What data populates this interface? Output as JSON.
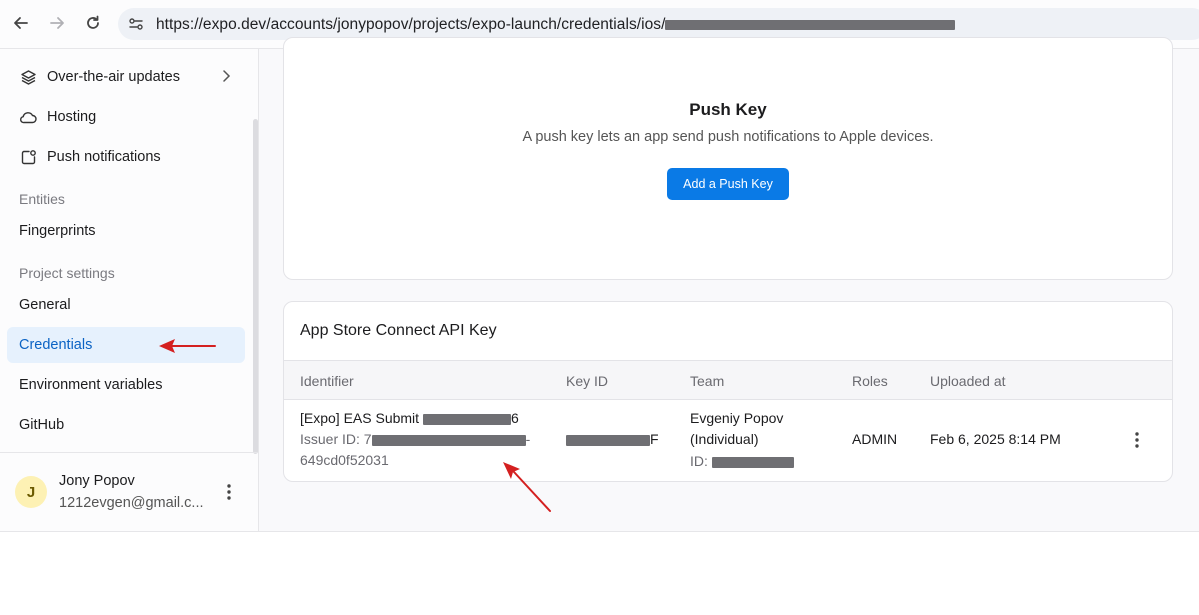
{
  "browser": {
    "url_visible": "https://expo.dev/accounts/jonypopov/projects/expo-launch/credentials/ios/"
  },
  "sidebar": {
    "items": [
      {
        "label": "Over-the-air updates"
      },
      {
        "label": "Hosting"
      },
      {
        "label": "Push notifications"
      }
    ],
    "sections": {
      "entities": "Entities",
      "project_settings": "Project settings"
    },
    "entities_items": [
      {
        "label": "Fingerprints"
      }
    ],
    "settings_items": [
      {
        "label": "General"
      },
      {
        "label": "Credentials"
      },
      {
        "label": "Environment variables"
      },
      {
        "label": "GitHub"
      }
    ],
    "user": {
      "initial": "J",
      "name": "Jony Popov",
      "email": "1212evgen@gmail.c..."
    }
  },
  "push_key": {
    "title": "Push Key",
    "description": "A push key lets an app send push notifications to Apple devices.",
    "button": "Add a Push Key"
  },
  "api_key": {
    "title": "App Store Connect API Key",
    "columns": [
      "Identifier",
      "Key ID",
      "Team",
      "Roles",
      "Uploaded at"
    ],
    "row": {
      "identifier_prefix": "[Expo] EAS Submit",
      "identifier_suffix": "6",
      "issuer_prefix": "Issuer ID: 7",
      "issuer_tail": "-",
      "issuer_line2": "649cd0f52031",
      "key_id_suffix": "F",
      "team_name": "Evgeniy Popov",
      "team_type": "(Individual)",
      "team_id_prefix": "ID:",
      "role": "ADMIN",
      "uploaded": "Feb 6, 2025 8:14 PM"
    }
  },
  "colors": {
    "accent": "#0a7ae6",
    "active_bg": "#e6f1fd",
    "active_text": "#0b63c4",
    "annotation_arrow": "#d42020"
  }
}
